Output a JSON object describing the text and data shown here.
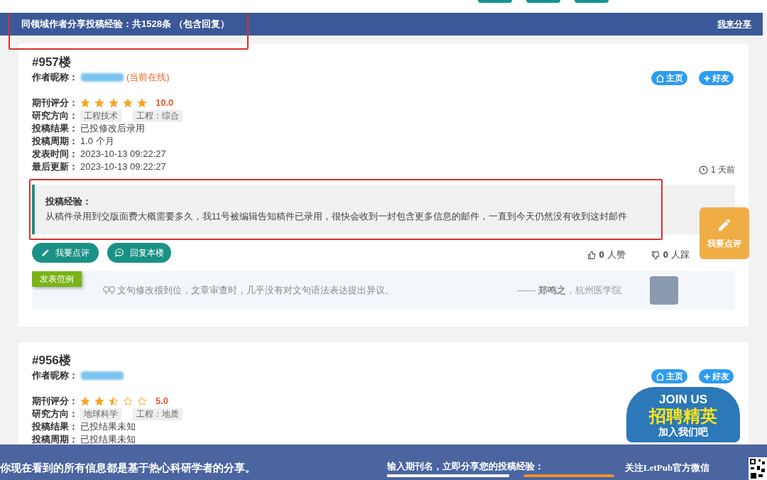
{
  "header": {
    "title": "同领域作者分享投稿经验：共1528条 （包含回复）",
    "share_link": "我来分享"
  },
  "posts": [
    {
      "floor": "#957楼",
      "nickname_label": "作者昵称：",
      "online": "(当前在线)",
      "home_button": "主页",
      "friend_button": "好友",
      "fields": [
        {
          "kind": "rating",
          "label": "期刊评分：",
          "stars": 5,
          "score": "10.0"
        },
        {
          "kind": "tags",
          "label": "研究方向：",
          "tags": [
            "工程技术",
            "工程：综合"
          ]
        },
        {
          "kind": "text",
          "label": "投稿结果：",
          "value": "已投修改后录用"
        },
        {
          "kind": "text",
          "label": "投稿周期：",
          "value": "1.0 个月"
        },
        {
          "kind": "text",
          "label": "发表时间：",
          "value": "2023-10-13 09:22:27"
        },
        {
          "kind": "text",
          "label": "最后更新：",
          "value": "2023-10-13 09:22:27"
        }
      ],
      "time_ago": "1 天前",
      "experience": {
        "title": "投稿经验：",
        "text": "从稿件录用到交版面费大概需要多久，我11号被编辑告知稿件已录用，很快会收到一封包含更多信息的邮件，一直到今天仍然没有收到这封邮件"
      },
      "comment_button": "我要点评",
      "reply_button": "回复本楼",
      "likes": "0",
      "likes_unit": "人赞",
      "dislikes": "0",
      "dislikes_unit": "人踩",
      "example": {
        "badge": "发表范例",
        "quote": "文句修改很到位，文章审查时，几乎没有对文句语法表达提出异议。",
        "dash": "——",
        "author": "郑鸣之",
        "affiliation": "，杭州医学院"
      }
    },
    {
      "floor": "#956楼",
      "nickname_label": "作者昵称：",
      "home_button": "主页",
      "friend_button": "好友",
      "fields": [
        {
          "kind": "rating",
          "label": "期刊评分：",
          "stars": 2.5,
          "score": "5.0"
        },
        {
          "kind": "tags",
          "label": "研究方向：",
          "tags": [
            "地球科学",
            "工程：地质"
          ]
        },
        {
          "kind": "text",
          "label": "投稿结果：",
          "value": "已投结果未知"
        },
        {
          "kind": "text",
          "label": "投稿周期：",
          "value": "已投结果未知"
        }
      ]
    }
  ],
  "float_button": "我要点评",
  "ad": {
    "line_1": "JOIN US",
    "line_2": "招聘精英",
    "line_3": "加入我们吧"
  },
  "bottom_bar": {
    "notice": "你现在看到的所有信息都是基于热心科研学者的分享。",
    "prompt": "输入期刊名，立即分享您的投稿经验：",
    "wechat": "关注LetPub官方微信"
  }
}
